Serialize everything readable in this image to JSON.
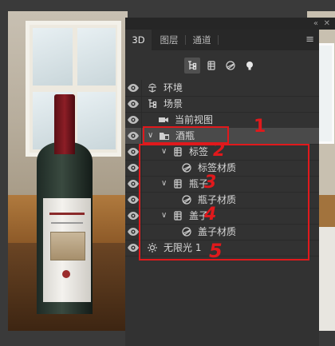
{
  "panel": {
    "tabs": [
      {
        "label": "3D",
        "active": true
      },
      {
        "label": "图层",
        "active": false
      },
      {
        "label": "通道",
        "active": false
      }
    ],
    "filters": [
      "scene-filter-icon",
      "mesh-filter-icon",
      "material-filter-icon",
      "light-filter-icon"
    ],
    "rows": [
      {
        "label": "环境",
        "icon": "environment-icon",
        "indent": 0
      },
      {
        "label": "场景",
        "icon": "scene-icon",
        "indent": 0
      },
      {
        "label": "当前视图",
        "icon": "camera-icon",
        "indent": 1
      },
      {
        "label": "酒瓶",
        "icon": "group-mesh-icon",
        "indent": 0,
        "selected": true,
        "expanded": true
      },
      {
        "label": "标签",
        "icon": "mesh-icon",
        "indent": 1,
        "expanded": true
      },
      {
        "label": "标签材质",
        "icon": "material-icon",
        "indent": 2
      },
      {
        "label": "瓶子",
        "icon": "mesh-icon",
        "indent": 1,
        "expanded": true
      },
      {
        "label": "瓶子材质",
        "icon": "material-icon",
        "indent": 2
      },
      {
        "label": "盖子",
        "icon": "mesh-icon",
        "indent": 1,
        "expanded": true
      },
      {
        "label": "盖子材质",
        "icon": "material-icon",
        "indent": 2
      },
      {
        "label": "无限光 1",
        "icon": "infinite-light-icon",
        "indent": 0
      }
    ]
  },
  "annotations": {
    "labels": [
      "1",
      "2",
      "3",
      "4",
      "5"
    ],
    "color": "#e0191c"
  },
  "colors": {
    "panel_bg": "#323232",
    "selected_row": "#4a4a4a",
    "text": "#d8d8d8"
  }
}
